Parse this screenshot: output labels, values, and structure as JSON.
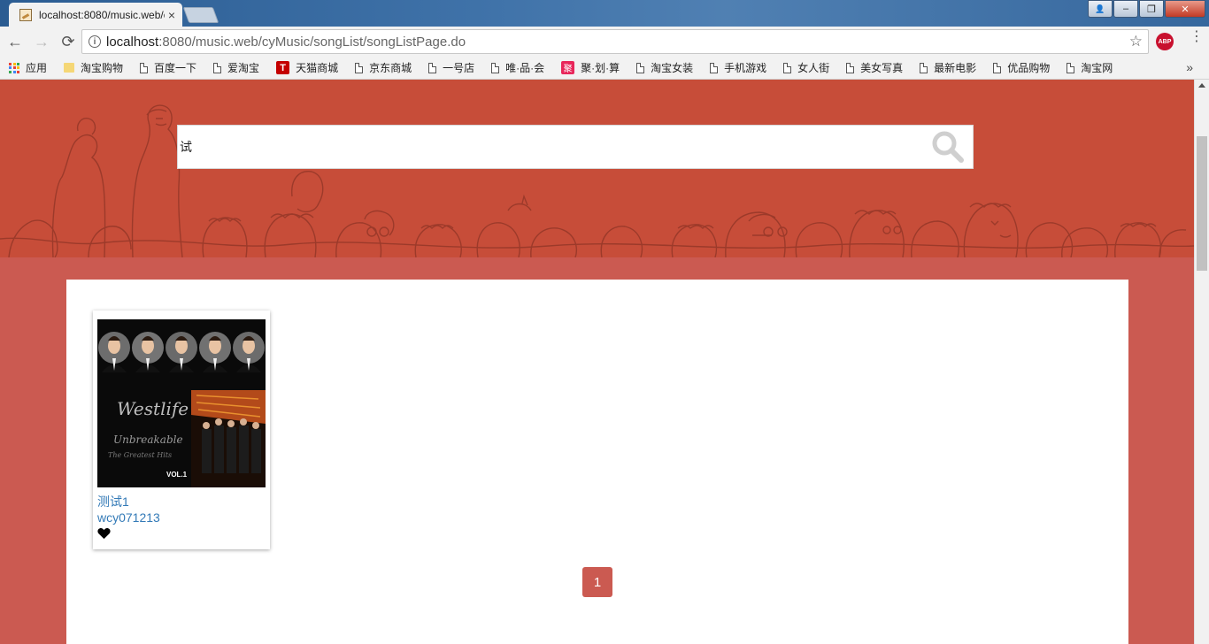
{
  "browser": {
    "tab_title": "localhost:8080/music.web/cyMusic/songList/songListPage.do",
    "tab_close": "×",
    "url_host": "localhost",
    "url_rest": ":8080/music.web/cyMusic/songList/songListPage.do",
    "nav": {
      "back": "←",
      "forward": "→",
      "reload": "⟳"
    },
    "star": "☆",
    "abp_label": "ABP",
    "menu": "⋮",
    "window_controls": {
      "user": "👤",
      "minimize": "–",
      "restore": "❐",
      "close": "✕"
    }
  },
  "bookmarks": {
    "items": [
      {
        "label": "应用",
        "icon": "apps-icon"
      },
      {
        "label": "淘宝购物",
        "icon": "folder-icon"
      },
      {
        "label": "百度一下",
        "icon": "page-icon"
      },
      {
        "label": "爱淘宝",
        "icon": "page-icon"
      },
      {
        "label": "天猫商城",
        "icon": "tmall-icon"
      },
      {
        "label": "京东商城",
        "icon": "page-icon"
      },
      {
        "label": "一号店",
        "icon": "page-icon"
      },
      {
        "label": "唯·品·会",
        "icon": "page-icon"
      },
      {
        "label": "聚·划·算",
        "icon": "ju-icon"
      },
      {
        "label": "淘宝女装",
        "icon": "page-icon"
      },
      {
        "label": "手机游戏",
        "icon": "page-icon"
      },
      {
        "label": "女人街",
        "icon": "page-icon"
      },
      {
        "label": "美女写真",
        "icon": "page-icon"
      },
      {
        "label": "最新电影",
        "icon": "page-icon"
      },
      {
        "label": "优品购物",
        "icon": "page-icon"
      },
      {
        "label": "淘宝网",
        "icon": "page-icon"
      }
    ],
    "tmall_glyph": "T",
    "ju_glyph": "聚",
    "more": "»"
  },
  "search": {
    "value": "试",
    "icon": "search-icon"
  },
  "songs": [
    {
      "title": "测试1",
      "author": "wcy071213",
      "cover_icon": "album-cover",
      "favorite_icon": "heart-icon"
    }
  ],
  "pagination": {
    "pages": [
      "1"
    ],
    "current": "1"
  },
  "colors": {
    "hero_bg": "#c74d39",
    "page_bg": "#cb5a51",
    "link": "#337ab7",
    "page_button": "#cb5a51"
  }
}
